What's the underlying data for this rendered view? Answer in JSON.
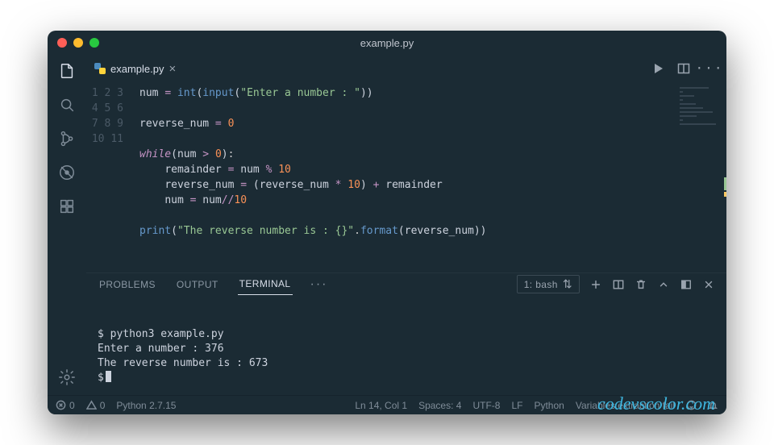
{
  "window": {
    "title": "example.py"
  },
  "tab": {
    "filename": "example.py"
  },
  "code_lines": [
    [
      [
        "id",
        "num"
      ],
      [
        "plain",
        " "
      ],
      [
        "op",
        "="
      ],
      [
        "plain",
        " "
      ],
      [
        "fn",
        "int"
      ],
      [
        "par",
        "("
      ],
      [
        "fn",
        "input"
      ],
      [
        "par",
        "("
      ],
      [
        "str",
        "\"Enter a number : \""
      ],
      [
        "par",
        "))"
      ]
    ],
    [],
    [
      [
        "id",
        "reverse_num"
      ],
      [
        "plain",
        " "
      ],
      [
        "op",
        "="
      ],
      [
        "plain",
        " "
      ],
      [
        "num",
        "0"
      ]
    ],
    [],
    [
      [
        "kw",
        "while"
      ],
      [
        "par",
        "("
      ],
      [
        "id",
        "num"
      ],
      [
        "plain",
        " "
      ],
      [
        "op",
        ">"
      ],
      [
        "plain",
        " "
      ],
      [
        "num",
        "0"
      ],
      [
        "par",
        ")"
      ],
      [
        "plain",
        ":"
      ]
    ],
    [
      [
        "plain",
        "    "
      ],
      [
        "id",
        "remainder"
      ],
      [
        "plain",
        " "
      ],
      [
        "op",
        "="
      ],
      [
        "plain",
        " "
      ],
      [
        "id",
        "num"
      ],
      [
        "plain",
        " "
      ],
      [
        "op",
        "%"
      ],
      [
        "plain",
        " "
      ],
      [
        "num",
        "10"
      ]
    ],
    [
      [
        "plain",
        "    "
      ],
      [
        "id",
        "reverse_num"
      ],
      [
        "plain",
        " "
      ],
      [
        "op",
        "="
      ],
      [
        "plain",
        " "
      ],
      [
        "par",
        "("
      ],
      [
        "id",
        "reverse_num"
      ],
      [
        "plain",
        " "
      ],
      [
        "op",
        "*"
      ],
      [
        "plain",
        " "
      ],
      [
        "num",
        "10"
      ],
      [
        "par",
        ")"
      ],
      [
        "plain",
        " "
      ],
      [
        "op",
        "+"
      ],
      [
        "plain",
        " "
      ],
      [
        "id",
        "remainder"
      ]
    ],
    [
      [
        "plain",
        "    "
      ],
      [
        "id",
        "num"
      ],
      [
        "plain",
        " "
      ],
      [
        "op",
        "="
      ],
      [
        "plain",
        " "
      ],
      [
        "id",
        "num"
      ],
      [
        "op",
        "//"
      ],
      [
        "num",
        "10"
      ]
    ],
    [],
    [
      [
        "fn",
        "print"
      ],
      [
        "par",
        "("
      ],
      [
        "str",
        "\"The reverse number is : {}\""
      ],
      [
        "plain",
        "."
      ],
      [
        "fn",
        "format"
      ],
      [
        "par",
        "("
      ],
      [
        "id",
        "reverse_num"
      ],
      [
        "par",
        "))"
      ]
    ],
    []
  ],
  "line_numbers": [
    "1",
    "2",
    "3",
    "4",
    "5",
    "6",
    "7",
    "8",
    "9",
    "10",
    "11"
  ],
  "panel": {
    "tabs": {
      "problems": "PROBLEMS",
      "output": "OUTPUT",
      "terminal": "TERMINAL"
    },
    "terminal_name": "1: bash"
  },
  "terminal_lines": [
    "$ python3 example.py",
    "Enter a number : 376",
    "The reverse number is : 673",
    "$"
  ],
  "status": {
    "errors": "0",
    "warnings": "0",
    "python": "Python 2.7.15",
    "position": "Ln 14, Col 1",
    "spaces": "Spaces: 4",
    "encoding": "UTF-8",
    "eol": "LF",
    "lang": "Python",
    "msg": "Variables extraction fail"
  },
  "watermark": "codevscolor.com"
}
